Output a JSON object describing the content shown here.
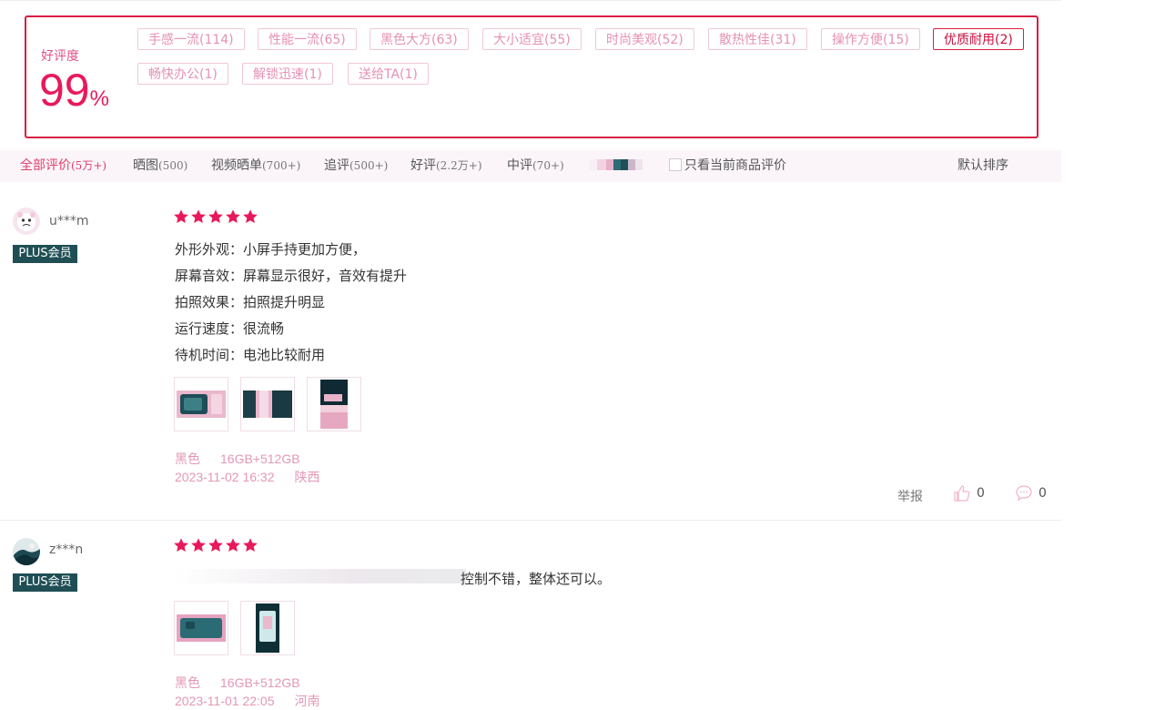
{
  "summary": {
    "rate_label": "好评度",
    "rate_value": "99",
    "rate_unit": "%",
    "tags": [
      {
        "label": "手感一流(114)",
        "active": false
      },
      {
        "label": "性能一流(65)",
        "active": false
      },
      {
        "label": "黑色大方(63)",
        "active": false
      },
      {
        "label": "大小适宜(55)",
        "active": false
      },
      {
        "label": "时尚美观(52)",
        "active": false
      },
      {
        "label": "散热性佳(31)",
        "active": false
      },
      {
        "label": "操作方便(15)",
        "active": false
      },
      {
        "label": "优质耐用(2)",
        "active": true
      },
      {
        "label": "畅快办公(1)",
        "active": false
      },
      {
        "label": "解锁迅速(1)",
        "active": false
      },
      {
        "label": "送给TA(1)",
        "active": false
      }
    ]
  },
  "filters": {
    "tabs": [
      {
        "label": "全部评价",
        "count": "(5万+)",
        "active": true
      },
      {
        "label": "晒图",
        "count": "(500)",
        "active": false
      },
      {
        "label": "视频晒单",
        "count": "(700+)",
        "active": false
      },
      {
        "label": "追评",
        "count": "(500+)",
        "active": false
      },
      {
        "label": "好评",
        "count": "(2.2万+)",
        "active": false
      },
      {
        "label": "中评",
        "count": "(70+)",
        "active": false
      }
    ],
    "only_current_label": "只看当前商品评价",
    "sort_label": "默认排序"
  },
  "reviews": [
    {
      "username": "u***m",
      "badge": "PLUS会员",
      "stars": 5,
      "lines": [
        "外形外观：小屏手持更加方便，",
        "屏幕音效：屏幕显示很好，音效有提升",
        "拍照效果：拍照提升明显",
        "运行速度：很流畅",
        "待机时间：电池比较耐用"
      ],
      "color": "黑色",
      "spec": "16GB+512GB",
      "date": "2023-11-02 16:32",
      "location": "陕西",
      "report_label": "举报",
      "likes": "0",
      "comments": "0"
    },
    {
      "username": "z***n",
      "badge": "PLUS会员",
      "stars": 5,
      "lines": [
        "控制不错，整体还可以。"
      ],
      "color": "黑色",
      "spec": "16GB+512GB",
      "date": "2023-11-01 22:05",
      "location": "河南"
    }
  ],
  "colors": {
    "accent": "#e8195a",
    "border_active": "#d81e41",
    "tag_text": "#e491b5",
    "plus_badge": "#1f4f55"
  }
}
